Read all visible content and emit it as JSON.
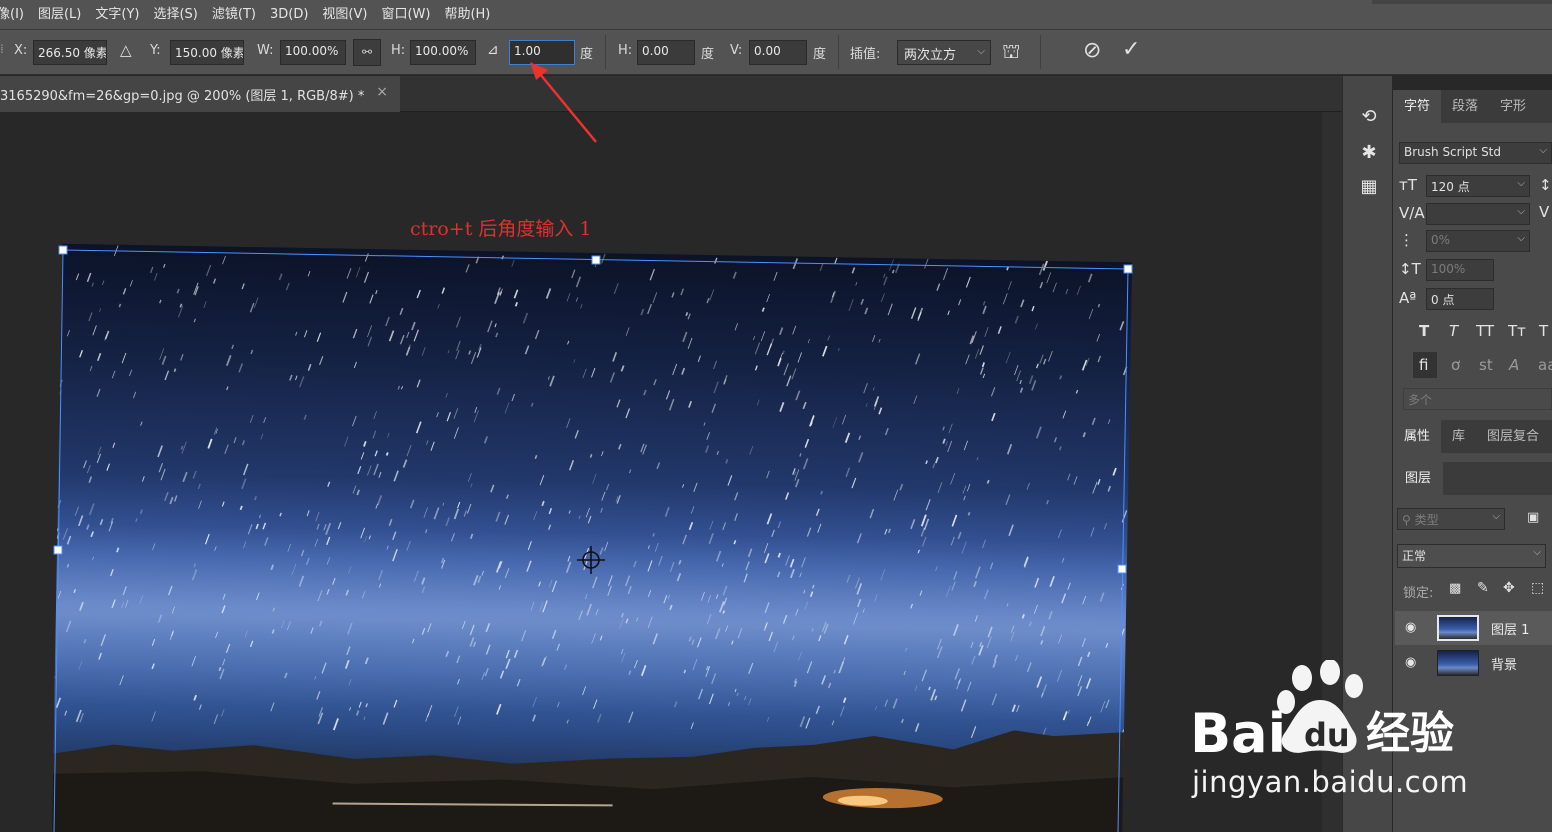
{
  "menu": [
    "像(I)",
    "图层(L)",
    "文字(Y)",
    "选择(S)",
    "滤镜(T)",
    "3D(D)",
    "视图(V)",
    "窗口(W)",
    "帮助(H)"
  ],
  "options": {
    "x_label": "X:",
    "x_value": "266.50 像素",
    "y_label": "Y:",
    "y_value": "150.00 像素",
    "w_label": "W:",
    "w_value": "100.00%",
    "h_label": "H:",
    "h_value": "100.00%",
    "angle_value": "1.00",
    "deg": "度",
    "hskew_label": "H:",
    "hskew_value": "0.00",
    "vskew_label": "V:",
    "vskew_value": "0.00",
    "interp_label": "插值:",
    "interp_value": "两次立方"
  },
  "doc_tab": {
    "title": "3165290&fm=26&gp=0.jpg @ 200% (图层 1, RGB/8#) *",
    "close": "×"
  },
  "annotation": "ctro+t 后角度输入 1",
  "character_panel": {
    "tabs": [
      "字符",
      "段落",
      "字形"
    ],
    "font_family": "Brush Script Std",
    "font_size": "120 点",
    "tracking": "0%",
    "vscale": "100%",
    "baseline": "0 点",
    "language": "多个",
    "style_buttons": [
      "T",
      "T",
      "TT",
      "Tт",
      "T"
    ],
    "opentype_buttons": [
      "fi",
      "ơ",
      "st",
      "A",
      "aa"
    ]
  },
  "props_panel": {
    "tabs": [
      "属性",
      "库",
      "图层复合"
    ]
  },
  "layers_panel": {
    "tab": "图层",
    "filter_placeholder": "类型",
    "blend_mode": "正常",
    "lock_label": "锁定:",
    "layers": [
      {
        "name": "图层 1",
        "selected": true
      },
      {
        "name": "背景",
        "selected": false
      }
    ]
  },
  "watermark": {
    "text": "jingyan.baidu.com"
  },
  "colors": {
    "accent": "#3c7fd6",
    "annotation": "#e0302e",
    "arrow": "#e8332f"
  }
}
